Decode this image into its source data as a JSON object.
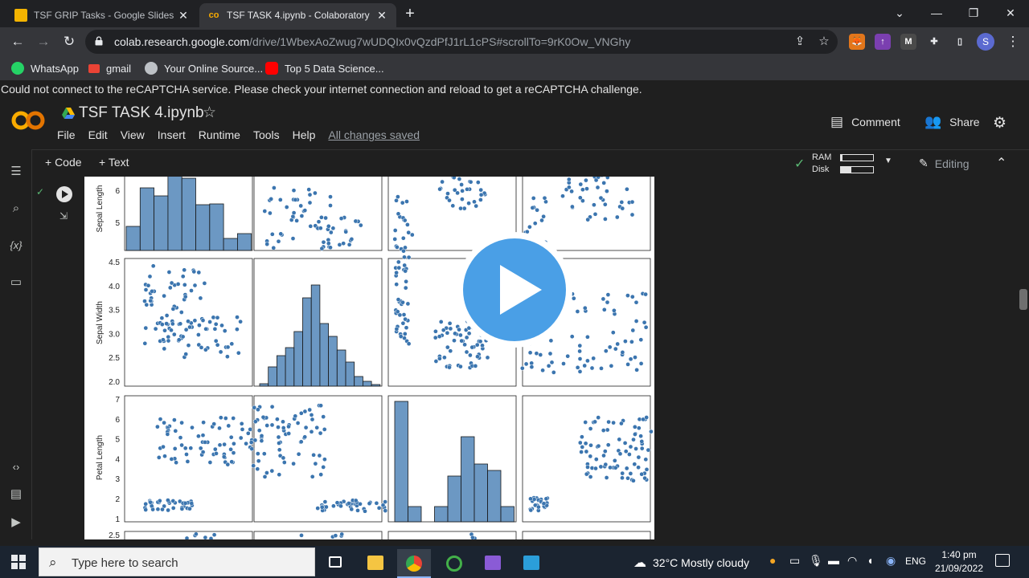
{
  "browser": {
    "tabs": [
      {
        "label": "TSF GRIP Tasks - Google Slides",
        "active": false
      },
      {
        "label": "TSF TASK 4.ipynb - Colaboratory",
        "active": true
      }
    ],
    "new_tab": "+",
    "url_host": "colab.research.google.com",
    "url_path": "/drive/1WbexAoZwug7wUDQIx0vQzdPfJ1rL1cPS#scrollTo=9rK0Ow_VNGhy",
    "profile_initial": "S",
    "extensions": [
      "M"
    ],
    "bookmarks": [
      {
        "label": "WhatsApp",
        "color": "#25d366"
      },
      {
        "label": "gmail",
        "color": "#ea4335"
      },
      {
        "label": "Your Online Source...",
        "color": "#e8eaed"
      },
      {
        "label": "Top 5 Data Science...",
        "color": "#ff0000"
      }
    ]
  },
  "warning": "Could not connect to the reCAPTCHA service. Please check your internet connection and reload to get a reCAPTCHA challenge.",
  "colab": {
    "logo": "CO",
    "title": "TSF TASK 4.ipynb",
    "menu": [
      "File",
      "Edit",
      "View",
      "Insert",
      "Runtime",
      "Tools",
      "Help"
    ],
    "saved_status": "All changes saved",
    "comment": "Comment",
    "share": "Share",
    "add_code": "+ Code",
    "add_text": "+ Text",
    "ram_label": "RAM",
    "disk_label": "Disk",
    "ram_usage": 0.05,
    "disk_usage": 0.32,
    "mode": "Editing"
  },
  "chart_data": {
    "type": "scatter",
    "title": "",
    "panels": [
      {
        "row_var": "Sepal Length",
        "col_var": "Sepal Length",
        "kind": "hist",
        "visible_yticks": [
          "6",
          "5"
        ]
      },
      {
        "row_var": "Sepal Width",
        "col_var": "Sepal Width",
        "kind": "hist",
        "visible_yticks": [
          "4.5",
          "4.0",
          "3.5",
          "3.0",
          "2.5",
          "2.0"
        ]
      },
      {
        "row_var": "Petal Length",
        "col_var": "Petal Length",
        "kind": "hist",
        "visible_yticks": [
          "7",
          "6",
          "5",
          "4",
          "3",
          "2",
          "1"
        ]
      }
    ],
    "y_axis_labels": [
      "Sepal Length",
      "Sepal Width",
      "Petal Length"
    ],
    "partial_row_tick": "2.5",
    "point_color": "#3b75af"
  },
  "taskbar": {
    "search_placeholder": "Type here to search",
    "weather": "32°C  Mostly cloudy",
    "lang": "ENG",
    "time": "1:40 pm",
    "date": "21/09/2022"
  }
}
